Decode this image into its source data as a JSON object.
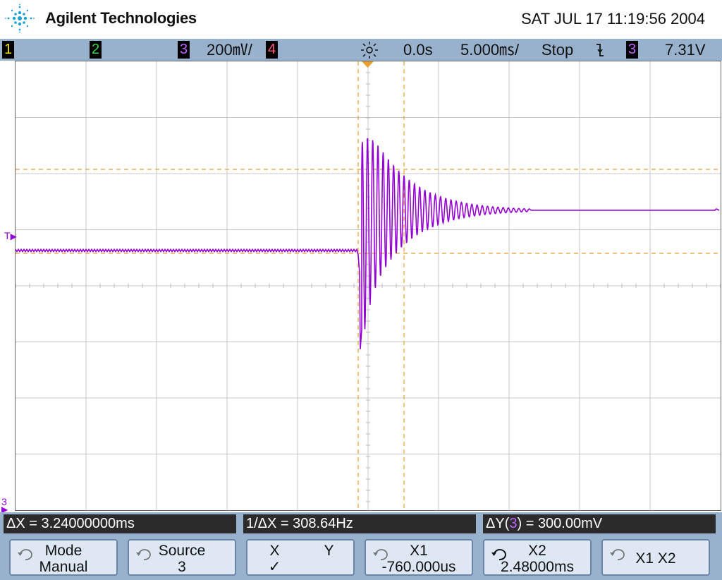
{
  "header": {
    "brand": "Agilent Technologies",
    "logo_icon": "agilent-spark-icon",
    "datetime": "SAT JUL 17 11:19:56 2004"
  },
  "status_bar": {
    "channels": [
      {
        "number": "1",
        "color": "#f5e600"
      },
      {
        "number": "2",
        "color": "#3ed34a"
      },
      {
        "number": "3",
        "color": "#c060ff",
        "scale": "200㎷/"
      },
      {
        "number": "4",
        "color": "#ff5a78"
      }
    ],
    "trigger_icon": "trigger-position-icon",
    "delay": "0.0s",
    "timebase": "5.000㎳/",
    "run_state": "Stop",
    "trigger_edge_icon": "falling-edge-icon",
    "trigger_source": "3",
    "trigger_level": "7.31V"
  },
  "display": {
    "trace_color": "#9400d3",
    "cursor_color": "#e8a030",
    "trigger_marker": "T",
    "ground_marker": "3"
  },
  "readouts": {
    "delta_x": "ΔX = 3.24000000ms",
    "inv_delta_x": "1/ΔX = 308.64Hz",
    "delta_y_prefix": "ΔY(",
    "delta_y_channel": "3",
    "delta_y_suffix": ") = 300.00mV"
  },
  "softkeys": [
    {
      "line1": "Mode",
      "line2": "Manual"
    },
    {
      "line1": "Source",
      "line2": "3"
    },
    {
      "line1": "X",
      "line1b": "Y",
      "line2": "✓"
    },
    {
      "line1": "X1",
      "line2": "-760.000us"
    },
    {
      "line1": "X2",
      "line2": "2.48000ms"
    },
    {
      "line1": "X1 X2",
      "line2": ""
    }
  ]
}
